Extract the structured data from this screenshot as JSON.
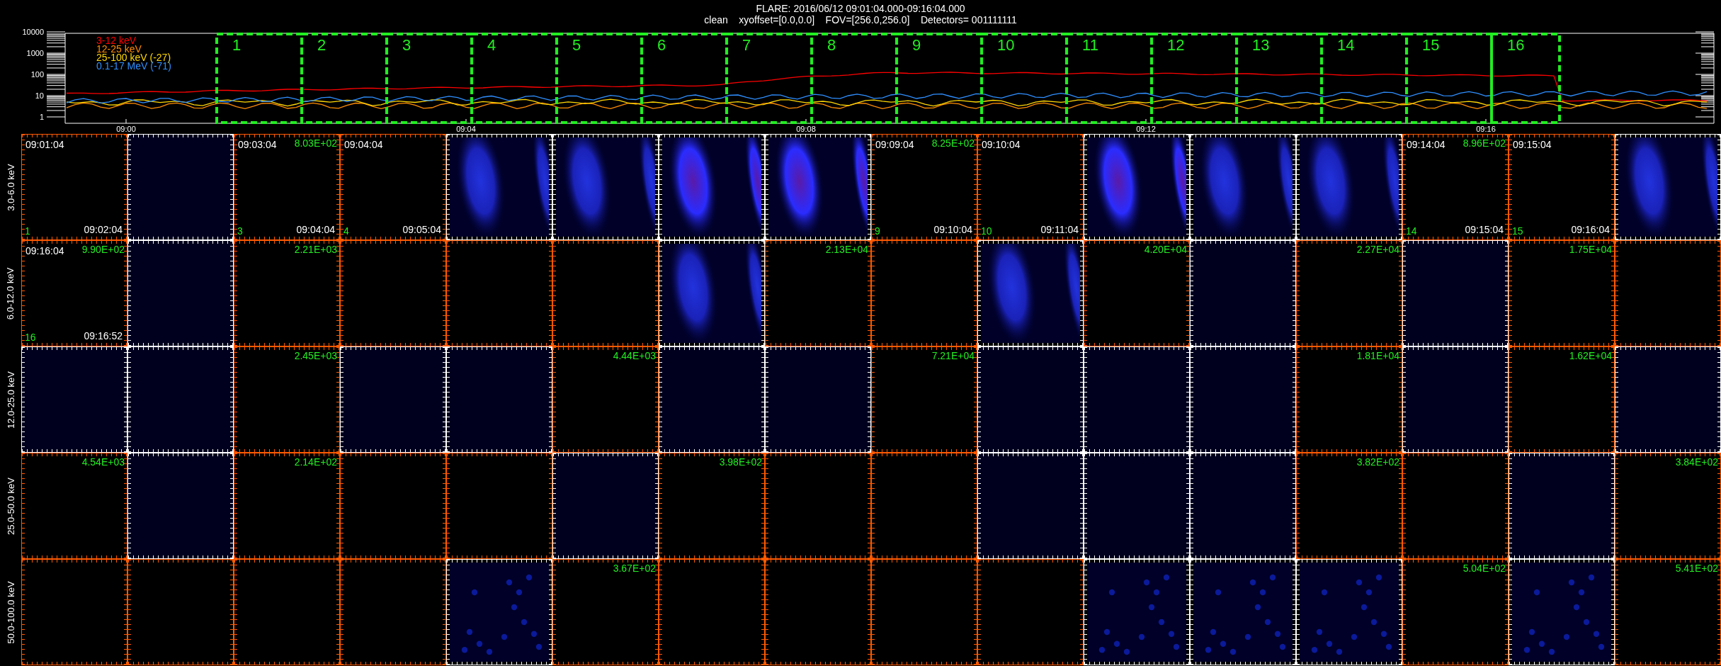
{
  "title": {
    "line_1": "FLARE: 2016/06/12 09:01:04.000-09:16:04.000",
    "line_2": "clean    xyoffset=[0.0,0.0]    FOV=[256.0,256.0]    Detectors= 001111111"
  },
  "light_curve": {
    "legend": [
      {
        "name": "3-12 keV",
        "color": "#ff0000"
      },
      {
        "name": "12-25 keV",
        "color": "#ff8c00"
      },
      {
        "name": "25-100 keV (-27)",
        "color": "#ffd800"
      },
      {
        "name": "0.1-17 MeV (-71)",
        "color": "#2f8fff"
      }
    ],
    "y_labels": [
      "10000",
      "1000",
      "100",
      "10",
      "1"
    ],
    "x_labels": [
      "09:00",
      "09:04",
      "09:08",
      "09:12",
      "09:16"
    ],
    "intervals": [
      "1",
      "2",
      "3",
      "4",
      "5",
      "6",
      "7",
      "8",
      "9",
      "10",
      "11",
      "12",
      "13",
      "14",
      "15",
      "16"
    ]
  },
  "rows": [
    {
      "label": "3.0-6.0 keV",
      "panels": [
        {
          "kind": "empty",
          "start_time": "09:01:04",
          "end_time": "09:02:04",
          "number": "1"
        },
        {
          "kind": "faint"
        },
        {
          "kind": "empty",
          "start_time": "09:03:04",
          "peak": "8.03E+02",
          "number": "3",
          "end_time": "09:04:04"
        },
        {
          "kind": "empty",
          "start_time": "09:04:04",
          "number": "4",
          "end_time": "09:05:04"
        },
        {
          "kind": "emission"
        },
        {
          "kind": "emission"
        },
        {
          "kind": "bright"
        },
        {
          "kind": "bright"
        },
        {
          "kind": "empty",
          "start_time": "09:09:04",
          "peak": "8.25E+02",
          "number": "9",
          "end_time": "09:10:04"
        },
        {
          "kind": "empty",
          "start_time": "09:10:04",
          "number": "10",
          "end_time": "09:11:04"
        },
        {
          "kind": "bright"
        },
        {
          "kind": "emission"
        },
        {
          "kind": "emission"
        },
        {
          "kind": "empty",
          "start_time": "09:14:04",
          "peak": "8.96E+02",
          "number": "14",
          "end_time": "09:15:04"
        },
        {
          "kind": "empty",
          "start_time": "09:15:04",
          "number": "15",
          "end_time": "09:16:04"
        },
        {
          "kind": "emission"
        }
      ]
    },
    {
      "label": "6.0-12.0 keV",
      "panels": [
        {
          "kind": "empty",
          "start_time": "09:16:04",
          "peak": "9.90E+02",
          "number": "16",
          "end_time": "09:16:52"
        },
        {
          "kind": "faint"
        },
        {
          "kind": "empty",
          "peak": "2.21E+03"
        },
        {
          "kind": "empty"
        },
        {
          "kind": "empty"
        },
        {
          "kind": "empty"
        },
        {
          "kind": "emission"
        },
        {
          "kind": "empty",
          "peak": "2.13E+04"
        },
        {
          "kind": "empty"
        },
        {
          "kind": "emission"
        },
        {
          "kind": "empty",
          "peak": "4.20E+04"
        },
        {
          "kind": "faint"
        },
        {
          "kind": "empty",
          "peak": "2.27E+04"
        },
        {
          "kind": "faint"
        },
        {
          "kind": "empty",
          "peak": "1.75E+04"
        },
        {
          "kind": "empty"
        }
      ]
    },
    {
      "label": "12.0-25.0 keV",
      "panels": [
        {
          "kind": "faint"
        },
        {
          "kind": "faint"
        },
        {
          "kind": "empty",
          "peak": "2.45E+03"
        },
        {
          "kind": "faint"
        },
        {
          "kind": "faint"
        },
        {
          "kind": "empty",
          "peak": "4.44E+03"
        },
        {
          "kind": "faint"
        },
        {
          "kind": "faint"
        },
        {
          "kind": "empty",
          "peak": "7.21E+04"
        },
        {
          "kind": "faint"
        },
        {
          "kind": "faint"
        },
        {
          "kind": "faint"
        },
        {
          "kind": "empty",
          "peak": "1.81E+04"
        },
        {
          "kind": "faint"
        },
        {
          "kind": "empty",
          "peak": "1.62E+04"
        },
        {
          "kind": "faint"
        }
      ]
    },
    {
      "label": "25.0-50.0 keV",
      "panels": [
        {
          "kind": "empty",
          "peak": "4.54E+03"
        },
        {
          "kind": "faint"
        },
        {
          "kind": "empty",
          "peak": "2.14E+02"
        },
        {
          "kind": "empty"
        },
        {
          "kind": "empty"
        },
        {
          "kind": "faint"
        },
        {
          "kind": "empty",
          "peak": "3.98E+02"
        },
        {
          "kind": "empty"
        },
        {
          "kind": "empty"
        },
        {
          "kind": "faint"
        },
        {
          "kind": "faint"
        },
        {
          "kind": "faint"
        },
        {
          "kind": "empty",
          "peak": "3.82E+02"
        },
        {
          "kind": "empty"
        },
        {
          "kind": "faint"
        },
        {
          "kind": "empty",
          "peak": "3.84E+02"
        }
      ]
    },
    {
      "label": "50.0-100.0 keV",
      "panels": [
        {
          "kind": "empty"
        },
        {
          "kind": "empty"
        },
        {
          "kind": "empty"
        },
        {
          "kind": "empty"
        },
        {
          "kind": "speckle"
        },
        {
          "kind": "empty",
          "peak": "3.67E+02"
        },
        {
          "kind": "empty"
        },
        {
          "kind": "empty"
        },
        {
          "kind": "empty"
        },
        {
          "kind": "empty"
        },
        {
          "kind": "speckle"
        },
        {
          "kind": "speckle"
        },
        {
          "kind": "speckle"
        },
        {
          "kind": "empty",
          "peak": "5.04E+02"
        },
        {
          "kind": "speckle"
        },
        {
          "kind": "empty",
          "peak": "5.41E+02"
        }
      ]
    }
  ]
}
